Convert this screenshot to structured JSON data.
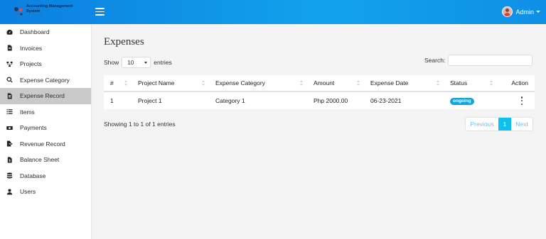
{
  "brand": {
    "title": "Accounting Management System"
  },
  "header": {
    "user_label": "Admin"
  },
  "sidebar": {
    "items": [
      {
        "label": "Dashboard",
        "icon": "dashboard-icon"
      },
      {
        "label": "Invoices",
        "icon": "file-icon"
      },
      {
        "label": "Projects",
        "icon": "sitemap-icon"
      },
      {
        "label": "Expense Category",
        "icon": "search-icon"
      },
      {
        "label": "Expense Record",
        "icon": "file-invoice-icon",
        "active": true
      },
      {
        "label": "Items",
        "icon": "list-icon"
      },
      {
        "label": "Payments",
        "icon": "money-icon"
      },
      {
        "label": "Revenue Record",
        "icon": "file-export-icon"
      },
      {
        "label": "Balance Sheet",
        "icon": "file-invoice-dollar-icon"
      },
      {
        "label": "Database",
        "icon": "database-icon"
      },
      {
        "label": "Users",
        "icon": "user-icon"
      }
    ]
  },
  "main": {
    "title": "Expenses",
    "length": {
      "show": "Show",
      "value": "10",
      "entries": "entries"
    },
    "search": {
      "label": "Search:",
      "value": ""
    },
    "table": {
      "headers": [
        "#",
        "Project Name",
        "Expense Category",
        "Amount",
        "Expense Date",
        "Status",
        "Action"
      ],
      "rows": [
        {
          "num": "1",
          "project": "Project 1",
          "category": "Category 1",
          "amount": "Php 2000.00",
          "date": "06-23-2021",
          "status": "ongoing"
        }
      ]
    },
    "info": "Showing 1 to 1 of 1 entries",
    "pagination": {
      "previous": "Previous",
      "current": "1",
      "next": "Next"
    }
  },
  "colors": {
    "accent": "#12a2ec",
    "active_nav": "#c9c9c9",
    "badge": "#17a2d8",
    "page_current": "#0dc0f0"
  }
}
